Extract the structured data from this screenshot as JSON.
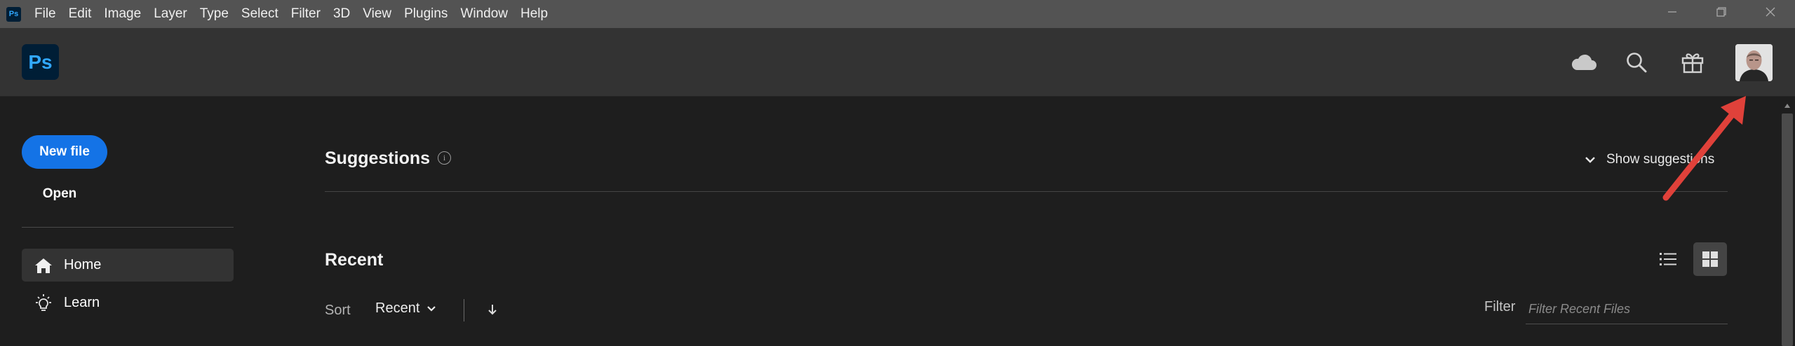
{
  "titlebar": {
    "app_badge": "Ps",
    "menu": [
      "File",
      "Edit",
      "Image",
      "Layer",
      "Type",
      "Select",
      "Filter",
      "3D",
      "View",
      "Plugins",
      "Window",
      "Help"
    ],
    "window_controls": {
      "minimize": "—",
      "restore": "❐",
      "close": "✕"
    }
  },
  "header": {
    "logo_text": "Ps",
    "icons": [
      "cloud-icon",
      "search-icon",
      "gift-icon"
    ],
    "avatar": "user-avatar"
  },
  "sidebar": {
    "new_file_label": "New file",
    "open_label": "Open",
    "nav": [
      {
        "label": "Home",
        "icon": "home-icon",
        "active": true
      },
      {
        "label": "Learn",
        "icon": "lightbulb-icon",
        "active": false
      }
    ]
  },
  "suggestions": {
    "title": "Suggestions",
    "info_icon": "i",
    "toggle_label": "Show suggestions"
  },
  "recent": {
    "title": "Recent",
    "sort_label": "Sort",
    "sort_value": "Recent",
    "filter_label": "Filter",
    "filter_placeholder": "Filter Recent Files",
    "view_mode": "grid"
  },
  "colors": {
    "accent": "#1473e6",
    "ps_brand": "#31a8ff",
    "annotation_arrow": "#e0413a"
  }
}
